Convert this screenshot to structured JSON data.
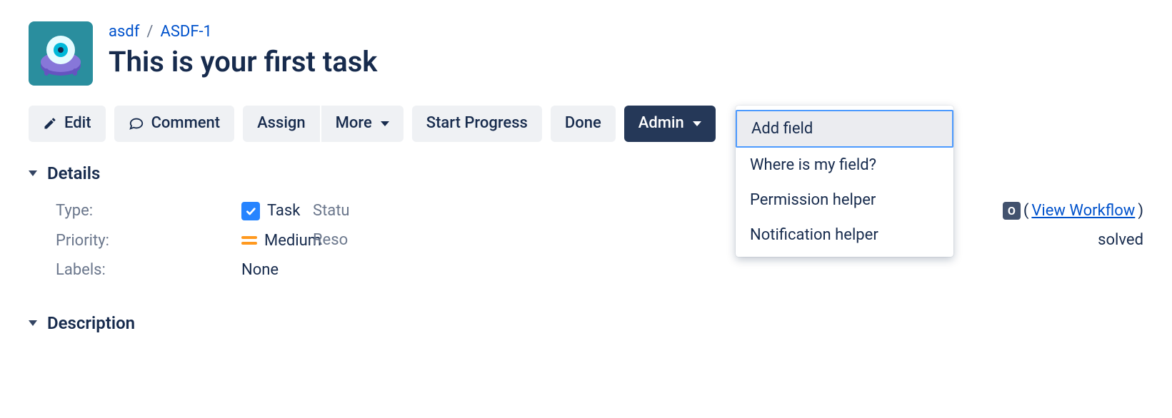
{
  "breadcrumb": {
    "project": "asdf",
    "issue_key": "ASDF-1"
  },
  "issue": {
    "title": "This is your first task"
  },
  "toolbar": {
    "edit": "Edit",
    "comment": "Comment",
    "assign": "Assign",
    "more": "More",
    "start_progress": "Start Progress",
    "done": "Done",
    "admin": "Admin"
  },
  "admin_menu": {
    "add_field": "Add field",
    "where_is_my_field": "Where is my field?",
    "permission_helper": "Permission helper",
    "notification_helper": "Notification helper"
  },
  "sections": {
    "details": "Details",
    "description": "Description"
  },
  "fields": {
    "type_label": "Type:",
    "type_value": "Task",
    "priority_label": "Priority:",
    "priority_value": "Medium",
    "labels_label": "Labels:",
    "labels_value": "None",
    "status_label": "Statu",
    "status_fragment_after": "O",
    "view_workflow": "View Workflow",
    "resolution_label": "Reso",
    "resolution_fragment": "solved"
  },
  "punct": {
    "paren_open": "(",
    "paren_close": ")"
  }
}
